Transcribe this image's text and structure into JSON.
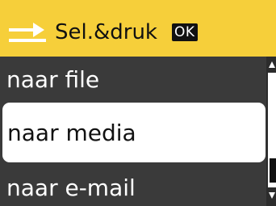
{
  "header": {
    "icon": "scan-arrow-icon",
    "title": "Sel.&druk",
    "ok_label": "OK"
  },
  "menu": {
    "items": [
      {
        "label": "naar file",
        "selected": false
      },
      {
        "label": "naar media",
        "selected": true
      },
      {
        "label": "naar e-mail",
        "selected": false
      }
    ]
  },
  "colors": {
    "header_bg": "#f6cf3a",
    "menu_bg": "#3a3a3a",
    "selected_bg": "#ffffff",
    "text_dark": "#111111",
    "text_light": "#ffffff"
  }
}
